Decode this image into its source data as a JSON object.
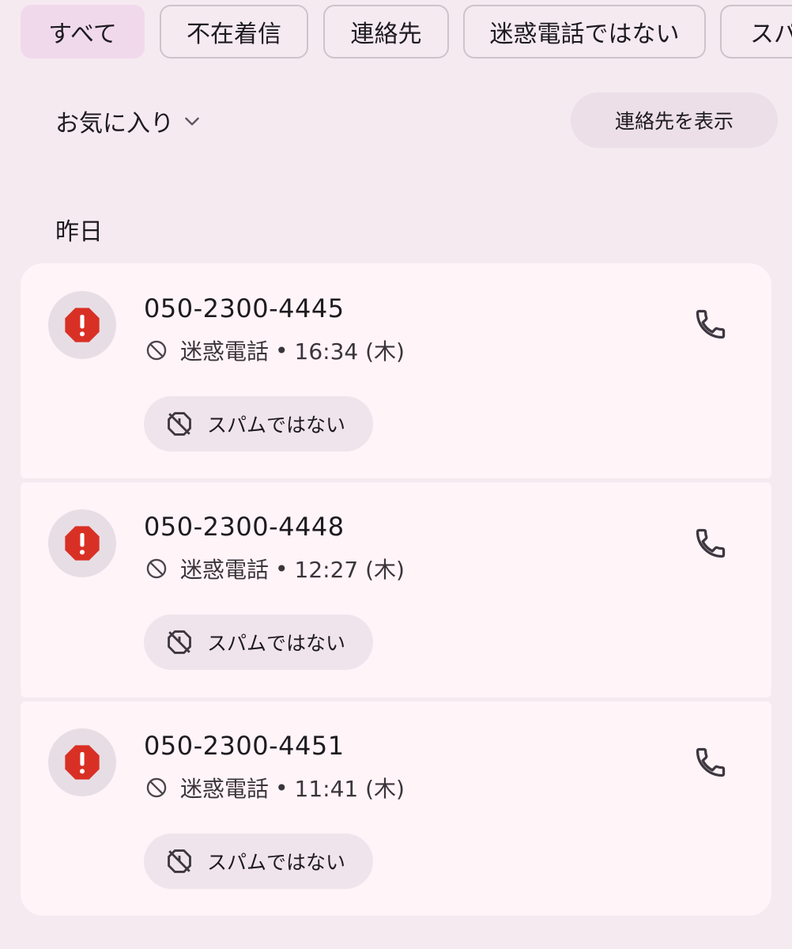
{
  "filters": [
    {
      "label": "すべて",
      "selected": true
    },
    {
      "label": "不在着信",
      "selected": false
    },
    {
      "label": "連絡先",
      "selected": false
    },
    {
      "label": "迷惑電話ではない",
      "selected": false
    },
    {
      "label": "スパ",
      "selected": false
    }
  ],
  "favorites": {
    "label": "お気に入り",
    "icon": "chevron-down-icon"
  },
  "contacts_button": "連絡先を表示",
  "section_title": "昨日",
  "calls": [
    {
      "number": "050-2300-4445",
      "status": "迷惑電話",
      "separator": "•",
      "time": "16:34 (木)",
      "action": "スパムではない"
    },
    {
      "number": "050-2300-4448",
      "status": "迷惑電話",
      "separator": "•",
      "time": "12:27 (木)",
      "action": "スパムではない"
    },
    {
      "number": "050-2300-4451",
      "status": "迷惑電話",
      "separator": "•",
      "time": "11:41 (木)",
      "action": "スパムではない"
    }
  ],
  "colors": {
    "background": "#f6eaf1",
    "card": "#fff4f8",
    "selected_chip": "#f1d9ec",
    "spam_icon": "#d93025"
  }
}
